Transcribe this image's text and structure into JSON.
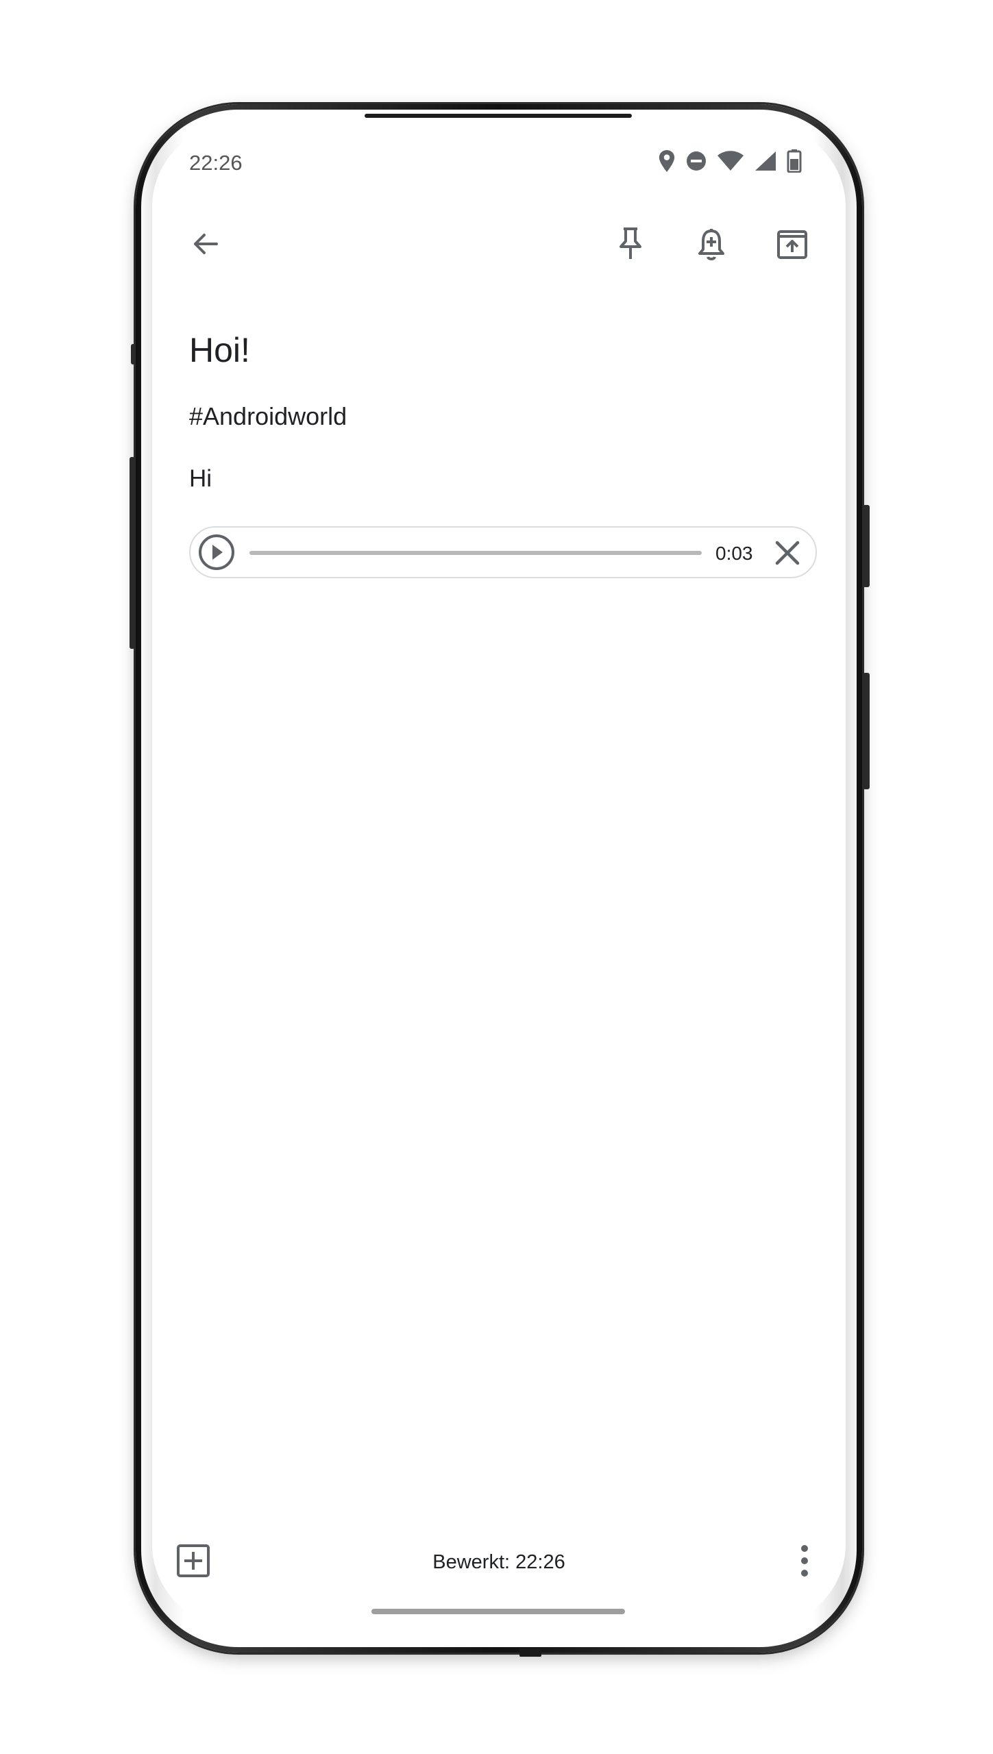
{
  "status_bar": {
    "time": "22:26",
    "icons": [
      "location-icon",
      "do-not-disturb-icon",
      "wifi-icon",
      "signal-icon",
      "battery-icon"
    ]
  },
  "toolbar": {
    "icons": [
      "back-arrow-icon",
      "pin-icon",
      "reminder-icon",
      "archive-icon"
    ]
  },
  "note": {
    "title": "Hoi!",
    "tag": "#Androidworld",
    "body": "Hi"
  },
  "audio": {
    "duration": "0:03",
    "progress": 0,
    "icons": [
      "play-icon",
      "close-icon"
    ]
  },
  "bottom_bar": {
    "edited": "Bewerkt: 22:26",
    "icons": [
      "add-box-icon",
      "more-vert-icon"
    ]
  },
  "colors": {
    "icon": "#5f6368",
    "text": "#202124",
    "track": "#b8b8b8",
    "border": "#dadce0"
  }
}
